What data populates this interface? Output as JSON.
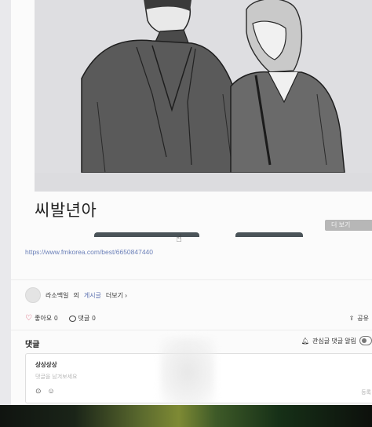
{
  "post": {
    "title": "씨발년아",
    "more_label": "더 보기",
    "source_link": "https://www.fmkorea.com/best/6650847440"
  },
  "author": {
    "name": "라소맥일",
    "suffix": "의",
    "posts_link": "게시글",
    "more": "더보기 ›"
  },
  "reactions": {
    "like_label": "좋아요",
    "like_count": "0",
    "comment_label": "댓글",
    "comment_count": "0",
    "share_label": "공유"
  },
  "comments": {
    "heading": "댓글",
    "notify_label": "관심글 댓글 알림",
    "box_name": "상상상상",
    "placeholder": "댓글을 남겨보세요",
    "submit_label": "등록"
  },
  "colors": {
    "link": "#6a7fb8",
    "heart": "#d23a57",
    "tab_bar": "#4a5358"
  }
}
